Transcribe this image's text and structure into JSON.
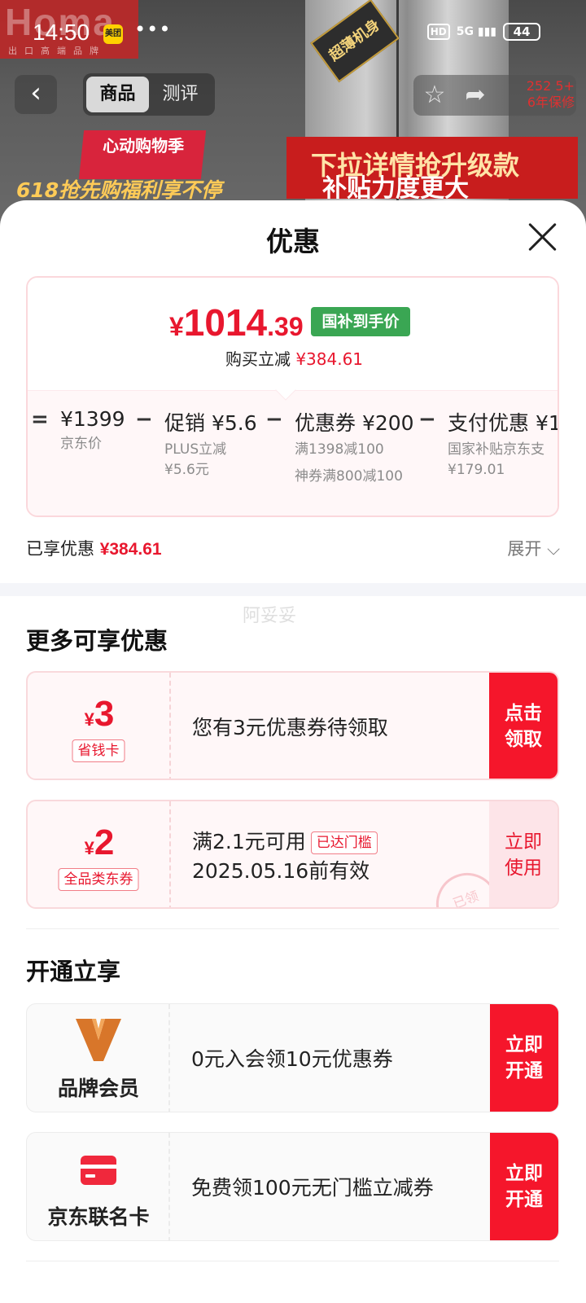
{
  "status_bar": {
    "time": "14:50",
    "app_badge": "美团",
    "dots": "•••",
    "hd": "HD",
    "network": "5G",
    "battery": "44"
  },
  "backdrop": {
    "brand": "Homa",
    "brand_sub": "出口高端品牌",
    "crown_text": "超薄机身",
    "promo_left_title": "心动购物季",
    "promo_left_line": "618抢先购福利享不停",
    "promo_right_line1": "下拉详情抢升级款",
    "promo_right_line2": "补贴力度更大",
    "warranty_count": "252 5+",
    "warranty_text": "6年保修"
  },
  "nav": {
    "back_icon": "chevron-left-icon",
    "tabs": [
      {
        "label": "商品",
        "active": true
      },
      {
        "label": "测评",
        "active": false
      }
    ],
    "star_icon": "star-icon",
    "share_icon": "share-icon"
  },
  "sheet": {
    "title": "优惠",
    "price": {
      "symbol": "¥",
      "integer": "1014",
      "decimal": ".39",
      "badge": "国补到手价",
      "reduce_label": "购买立减",
      "reduce_value": "¥384.61"
    },
    "calc": {
      "eq": "=",
      "minus": "−",
      "items": [
        {
          "main": "¥1399",
          "sub1": "京东价"
        },
        {
          "main": "促销 ¥5.6",
          "sub1": "PLUS立减",
          "sub2": "¥5.6元"
        },
        {
          "main": "优惠券 ¥200",
          "sub1": "满1398减100",
          "sub2": "神券满800减100"
        },
        {
          "main": "支付优惠 ¥1",
          "sub1": "国家补贴京东支",
          "sub2": "¥179.01"
        }
      ]
    },
    "enjoyed_label": "已享优惠",
    "enjoyed_value": "¥384.61",
    "expand_label": "展开 ⌵",
    "watermark": "阿妥妥",
    "more_title": "更多可享优惠",
    "coupons": [
      {
        "symbol": "¥",
        "amount": "3",
        "tag": "省钱卡",
        "desc": "您有3元优惠券待领取",
        "action": "点击领取"
      },
      {
        "symbol": "¥",
        "amount": "2",
        "tag": "全品类东券",
        "desc_line1": "满2.1元可用",
        "cond_tag": "已达门槛",
        "desc_line2": "2025.05.16前有效",
        "action": "立即使用",
        "stamp": "已领"
      }
    ],
    "open_title": "开通立享",
    "members": [
      {
        "icon": "brand-v-logo-icon",
        "label": "品牌会员",
        "desc": "0元入会领10元优惠券",
        "action": "立即开通"
      },
      {
        "icon": "credit-card-icon",
        "label": "京东联名卡",
        "desc": "免费领100元无门槛立减券",
        "action": "立即开通"
      }
    ],
    "colors": {
      "accent": "#f5162b",
      "price_red": "#e8172e",
      "gov_green": "#3aa653"
    }
  }
}
